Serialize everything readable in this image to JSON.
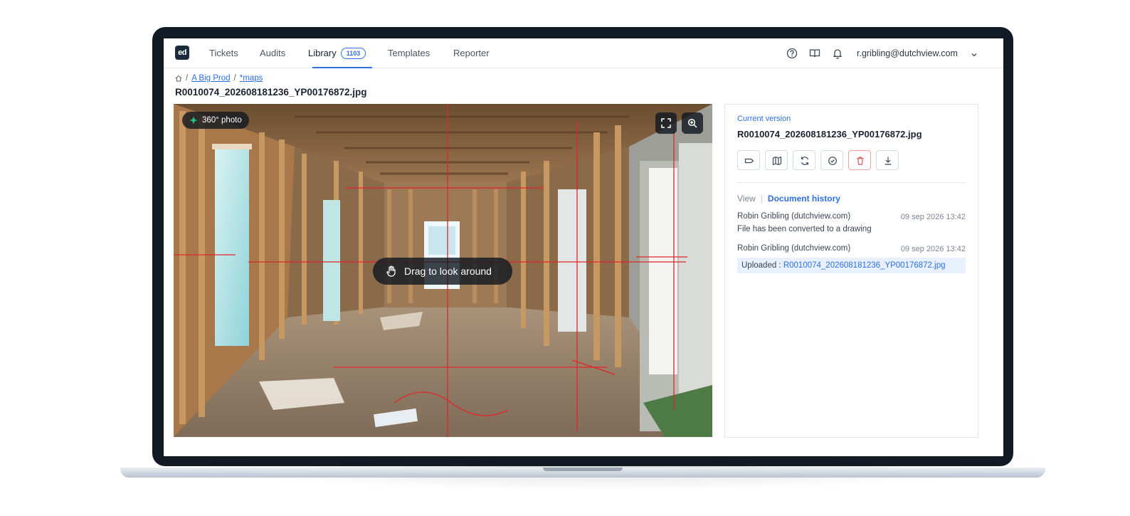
{
  "nav": {
    "logo": "ed",
    "tabs": [
      {
        "label": "Tickets"
      },
      {
        "label": "Audits"
      },
      {
        "label": "Library",
        "badge": "1103",
        "active": true
      },
      {
        "label": "Templates"
      },
      {
        "label": "Reporter"
      }
    ],
    "icons": [
      "help-icon",
      "book-icon",
      "bell-icon"
    ],
    "user_email": "r.gribling@dutchview.com"
  },
  "breadcrumb": {
    "items": [
      "A Big Prod",
      "*maps"
    ],
    "separator": "/"
  },
  "file_title": "R0010074_202608181236_YP00176872.jpg",
  "viewer": {
    "badge": "360° photo",
    "hint": "Drag to look around",
    "controls": [
      "fullscreen-icon",
      "zoom-in-icon"
    ]
  },
  "panel": {
    "version_label": "Current version",
    "version_name": "R0010074_202608181236_YP00176872.jpg",
    "tools": [
      "tag-icon",
      "map-icon",
      "refresh-icon",
      "check-circle-icon",
      "trash-icon",
      "download-icon"
    ],
    "history_tabs": {
      "view": "View",
      "history": "Document history"
    },
    "history": [
      {
        "who": "Robin Gribling (dutchview.com)",
        "when": "09 sep 2026 13:42",
        "message": "File has been converted to a drawing"
      },
      {
        "who": "Robin Gribling (dutchview.com)",
        "when": "09 sep 2026 13:42",
        "message_prefix": "Uploaded :",
        "message_link": "R0010074_202608181236_YP00176872.jpg"
      }
    ]
  },
  "colors": {
    "accent": "#2d6fe3",
    "bezel": "#111a25",
    "danger": "#e05252",
    "overlay_lines": "#e0262b"
  }
}
